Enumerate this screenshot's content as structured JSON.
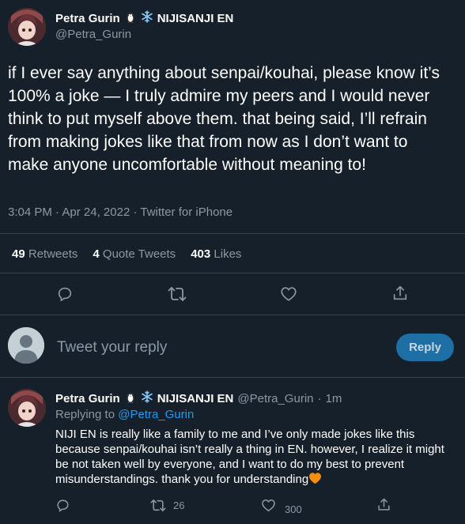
{
  "main_tweet": {
    "display_name": "Petra Gurin",
    "affiliation": "NIJISANJI EN",
    "handle": "@Petra_Gurin",
    "text": "if I ever say anything about senpai/kouhai, please know it’s 100% a joke — I truly admire my peers and I would never think to put myself above them. that being said, I’ll refrain from making jokes like that from now as I don’t want to make anyone uncomfortable without meaning to!",
    "time": "3:04 PM",
    "date": "Apr 24, 2022",
    "separator": "·",
    "client": "Twitter for iPhone",
    "stats": {
      "retweets_count": "49",
      "retweets_label": "Retweets",
      "quotes_count": "4",
      "quotes_label": "Quote Tweets",
      "likes_count": "403",
      "likes_label": "Likes"
    }
  },
  "composer": {
    "placeholder": "Tweet your reply",
    "button_label": "Reply"
  },
  "reply_tweet": {
    "display_name": "Petra Gurin",
    "affiliation": "NIJISANJI EN",
    "handle": "@Petra_Gurin",
    "separator": "·",
    "age": "1m",
    "replying_to_label": "Replying to",
    "replying_to_handle": "@Petra_Gurin",
    "text": "NIJI EN is really like a family to me and I’ve only made jokes like this because senpai/kouhai isn’t really a thing in EN. however, I realize it might be not taken well by everyone, and I want to do my best to prevent misunderstandings. thank you for understanding",
    "text_emoji": "orange-heart",
    "retweet_count": "26",
    "like_count": "300"
  },
  "icons": {
    "name_badge_1": "penguin-icon",
    "name_badge_2": "snowflake-icon",
    "reply": "reply-icon",
    "retweet": "retweet-icon",
    "like": "heart-icon",
    "share": "share-icon"
  },
  "colors": {
    "background": "#15202b",
    "text": "#ffffff",
    "muted": "#8b98a5",
    "link": "#1d9bf0",
    "divider": "#38444d",
    "reply_button": "#1d6fa5",
    "orange_heart": "#f4900c"
  }
}
